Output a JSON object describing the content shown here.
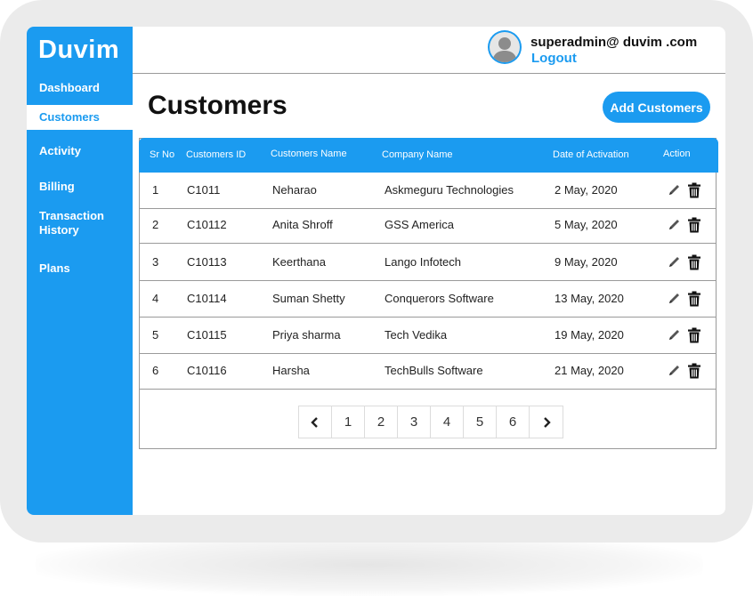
{
  "app": {
    "brand": "Duvim"
  },
  "sidebar": {
    "items": [
      {
        "label": "Dashboard"
      },
      {
        "label": "Customers",
        "active": true
      },
      {
        "label": "Activity"
      },
      {
        "label": "Billing"
      },
      {
        "label": "Transaction History"
      },
      {
        "label": "Plans"
      }
    ]
  },
  "header": {
    "user_email": "superadmin@ duvim .com",
    "logout_label": "Logout",
    "avatar_icon": "user-avatar-icon"
  },
  "page": {
    "title": "Customers",
    "add_button_label": "Add Customers"
  },
  "table": {
    "columns": [
      "Sr No",
      "Customers ID",
      "Customers Name",
      "Company Name",
      "Date of Activation",
      "Action"
    ],
    "rows": [
      {
        "sr": "1",
        "id": "C1011",
        "name": "Neharao",
        "company": "Askmeguru Technologies",
        "date": "2 May, 2020"
      },
      {
        "sr": "2",
        "id": "C10112",
        "name": "Anita Shroff",
        "company": "GSS America",
        "date": "5 May, 2020"
      },
      {
        "sr": "3",
        "id": "C10113",
        "name": "Keerthana",
        "company": "Lango Infotech",
        "date": "9 May, 2020"
      },
      {
        "sr": "4",
        "id": "C10114",
        "name": "Suman Shetty",
        "company": "Conquerors Software",
        "date": "13 May, 2020"
      },
      {
        "sr": "5",
        "id": "C10115",
        "name": "Priya sharma",
        "company": "Tech Vedika",
        "date": "19 May, 2020"
      },
      {
        "sr": "6",
        "id": "C10116",
        "name": "Harsha",
        "company": "TechBulls Software",
        "date": "21 May, 2020"
      }
    ],
    "action_icons": [
      "pencil-icon",
      "trash-icon"
    ]
  },
  "pagination": {
    "prev_icon": "chevron-left-icon",
    "pages": [
      "1",
      "2",
      "3",
      "4",
      "5",
      "6"
    ],
    "next_icon": "chevron-right-icon"
  },
  "colors": {
    "accent": "#1b9bf0",
    "frame": "#ebebeb",
    "text": "#111111"
  }
}
